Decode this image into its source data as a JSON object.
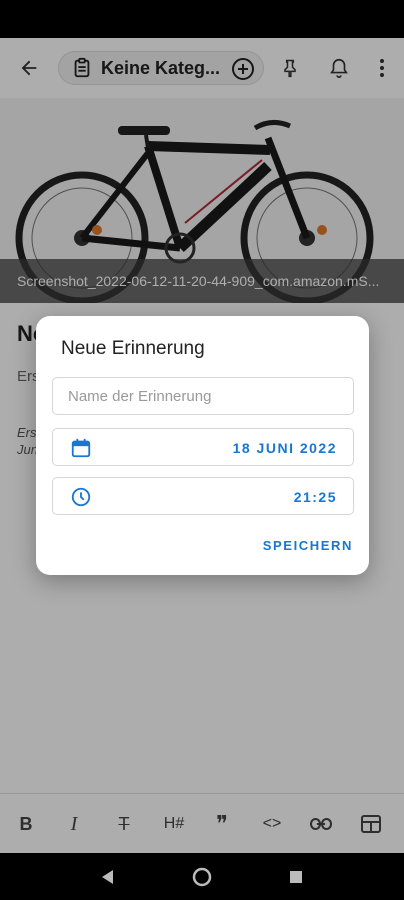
{
  "toolbar": {
    "category_label": "Keine Kateg...",
    "icons": [
      "back-arrow-icon",
      "clipboard-icon",
      "add-circle-icon",
      "pin-icon",
      "bell-icon",
      "more-vert-icon"
    ]
  },
  "image": {
    "caption": "Screenshot_2022-06-12-11-20-44-909_com.amazon.mS...",
    "description": "black mountain bike"
  },
  "note": {
    "title": "No",
    "body": "Ers",
    "meta_line1": "Ers",
    "meta_line2": "Jun"
  },
  "dialog": {
    "title": "Neue Erinnerung",
    "name_placeholder": "Name der Erinnerung",
    "name_value": "",
    "date_value": "18 JUNI 2022",
    "time_value": "21:25",
    "save_label": "SPEICHERN"
  },
  "format_bar": {
    "bold": "B",
    "italic": "I",
    "strikethrough": "T",
    "heading": "H#",
    "quote": "❞",
    "code": "<>"
  },
  "colors": {
    "accent": "#1976d2",
    "scrim": "rgba(0,0,0,0.32)"
  }
}
